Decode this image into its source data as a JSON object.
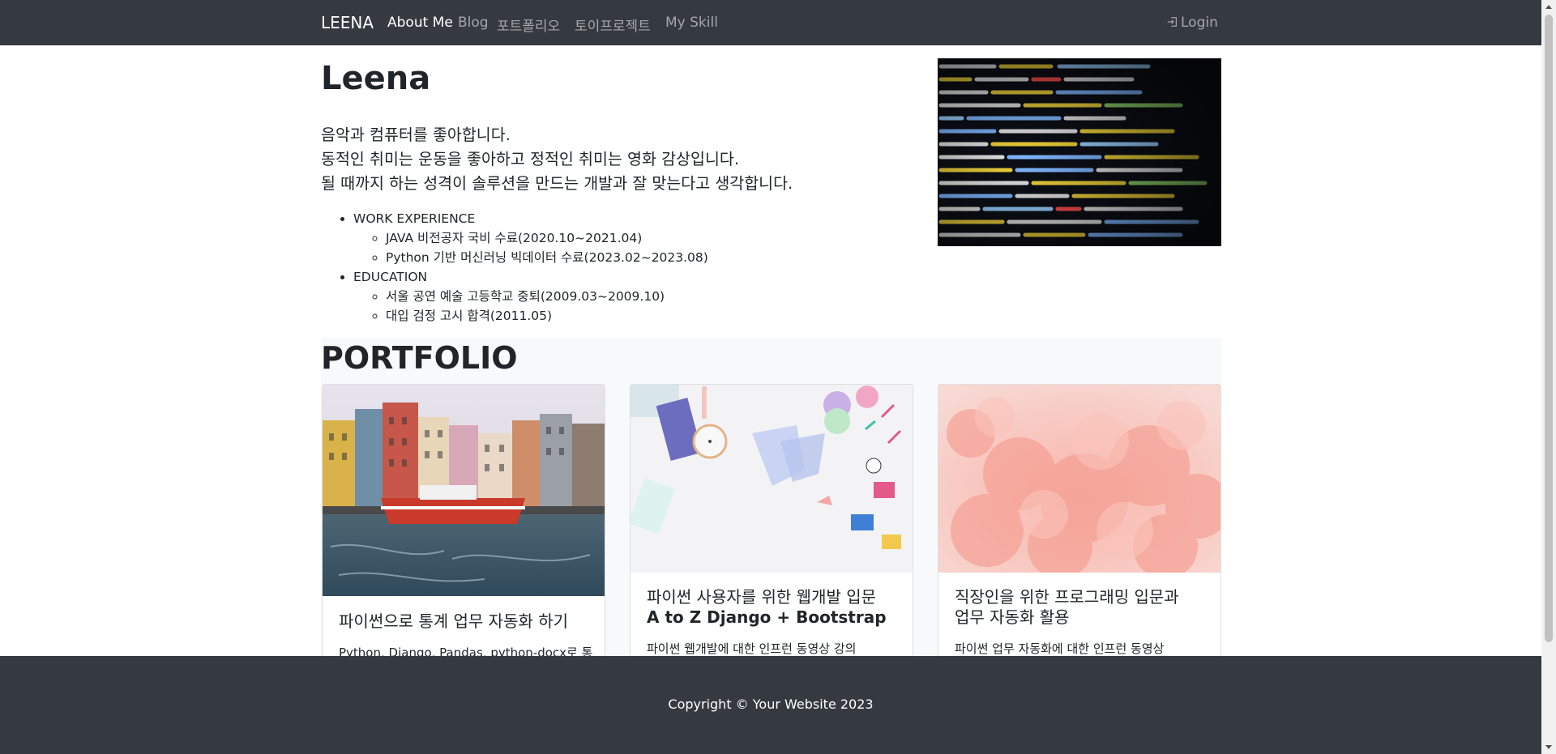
{
  "navbar": {
    "brand": "LEENA",
    "items": [
      "About Me",
      "Blog",
      "포트폴리오",
      "토이프로젝트",
      "My Skill"
    ],
    "active_index": 0,
    "login_label": "Login",
    "login_icon": "login-icon"
  },
  "about": {
    "title": "Leena",
    "lead": [
      "음악과 컴퓨터를 좋아합니다.",
      "동적인 취미는 운동을 좋아하고 정적인 취미는 영화 감상입니다.",
      "될 때까지 하는 성격이 솔루션을 만드는 개발과 잘 맞는다고 생각합니다."
    ],
    "sections": [
      {
        "heading": "WORK EXPERIENCE",
        "items": [
          "JAVA 비전공자 국비 수료(2020.10~2021.04)",
          "Python 기반 머신러닝 빅데이터 수료(2023.02~2023.08)"
        ]
      },
      {
        "heading": "EDUCATION",
        "items": [
          "서울 공연 예술 고등학교 중퇴(2009.03~2009.10)",
          "대입 검정 고시 합격(2011.05)"
        ]
      }
    ]
  },
  "portfolio": {
    "title": "PORTFOLIO",
    "cards": [
      {
        "title": "파이썬으로 통계 업무 자동화 하기",
        "title_bold": "",
        "text": "Python, Django, Pandas, python-docx로 통"
      },
      {
        "title": "파이썬 사용자를 위한 웹개발 입문",
        "title_bold": "A to Z Django + Bootstrap",
        "text": "파이썬 웹개발에 대한 인프런 동영상 강의"
      },
      {
        "title": "직장인을 위한 프로그래밍 입문과",
        "title_bold": "업무 자동화 활용",
        "text": "파이썬 업무 자동화에 대한 인프런 동영상"
      }
    ]
  },
  "footer": {
    "copyright": "Copyright © Your Website 2023"
  },
  "colors": {
    "navbar": "#343a40",
    "footer": "#343a40",
    "portfolio_bg": "#f8f9fa"
  }
}
